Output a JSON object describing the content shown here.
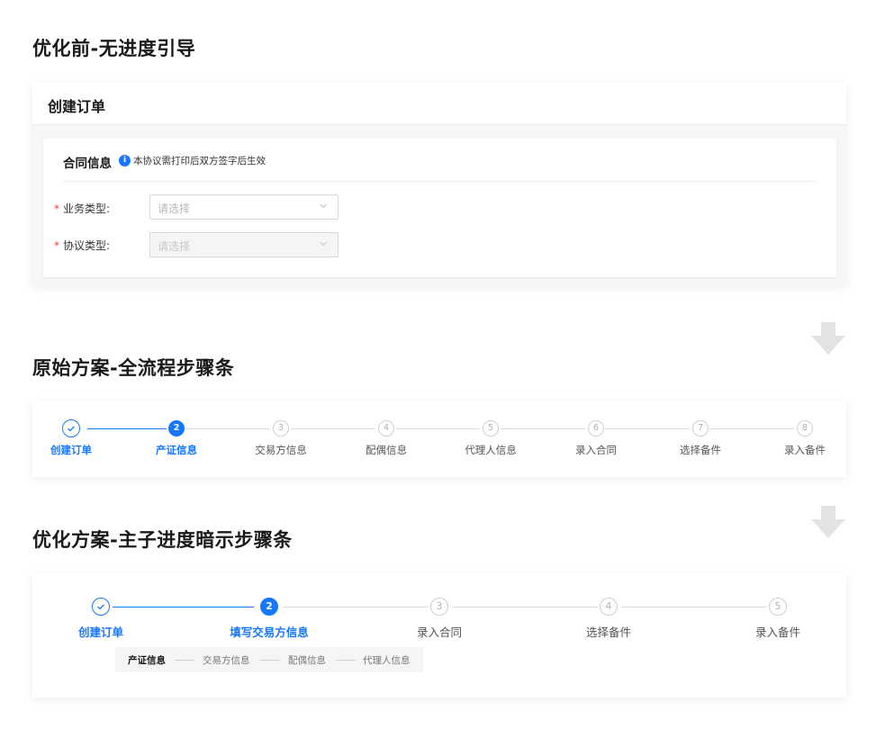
{
  "section1": {
    "title": "优化前-无进度引导",
    "header_title": "创建订单",
    "contract_title": "合同信息",
    "info_icon": "info-icon",
    "info_text": "本协议需打印后双方签字后生效",
    "fields": [
      {
        "label": "业务类型:",
        "placeholder": "请选择",
        "disabled": false
      },
      {
        "label": "协议类型:",
        "placeholder": "请选择",
        "disabled": true
      }
    ],
    "required_mark": "*"
  },
  "section2": {
    "title": "原始方案-全流程步骤条",
    "current_step": 2,
    "steps": [
      {
        "num": "1",
        "label": "创建订单",
        "state": "done"
      },
      {
        "num": "2",
        "label": "产证信息",
        "state": "active"
      },
      {
        "num": "3",
        "label": "交易方信息",
        "state": "pending"
      },
      {
        "num": "4",
        "label": "配偶信息",
        "state": "pending"
      },
      {
        "num": "5",
        "label": "代理人信息",
        "state": "pending"
      },
      {
        "num": "6",
        "label": "录入合同",
        "state": "pending"
      },
      {
        "num": "7",
        "label": "选择备件",
        "state": "pending"
      },
      {
        "num": "8",
        "label": "录入备件",
        "state": "pending"
      }
    ]
  },
  "section3": {
    "title": "优化方案-主子进度暗示步骤条",
    "current_step": 2,
    "steps": [
      {
        "num": "1",
        "label": "创建订单",
        "state": "done"
      },
      {
        "num": "2",
        "label": "填写交易方信息",
        "state": "active"
      },
      {
        "num": "3",
        "label": "录入合同",
        "state": "pending"
      },
      {
        "num": "4",
        "label": "选择备件",
        "state": "pending"
      },
      {
        "num": "5",
        "label": "录入备件",
        "state": "pending"
      }
    ],
    "sub_steps": [
      {
        "label": "产证信息",
        "current": true
      },
      {
        "label": "交易方信息",
        "current": false
      },
      {
        "label": "配偶信息",
        "current": false
      },
      {
        "label": "代理人信息",
        "current": false
      }
    ]
  },
  "colors": {
    "accent": "#1677ff",
    "required": "#e8403a",
    "arrow": "#e3e3e3"
  }
}
